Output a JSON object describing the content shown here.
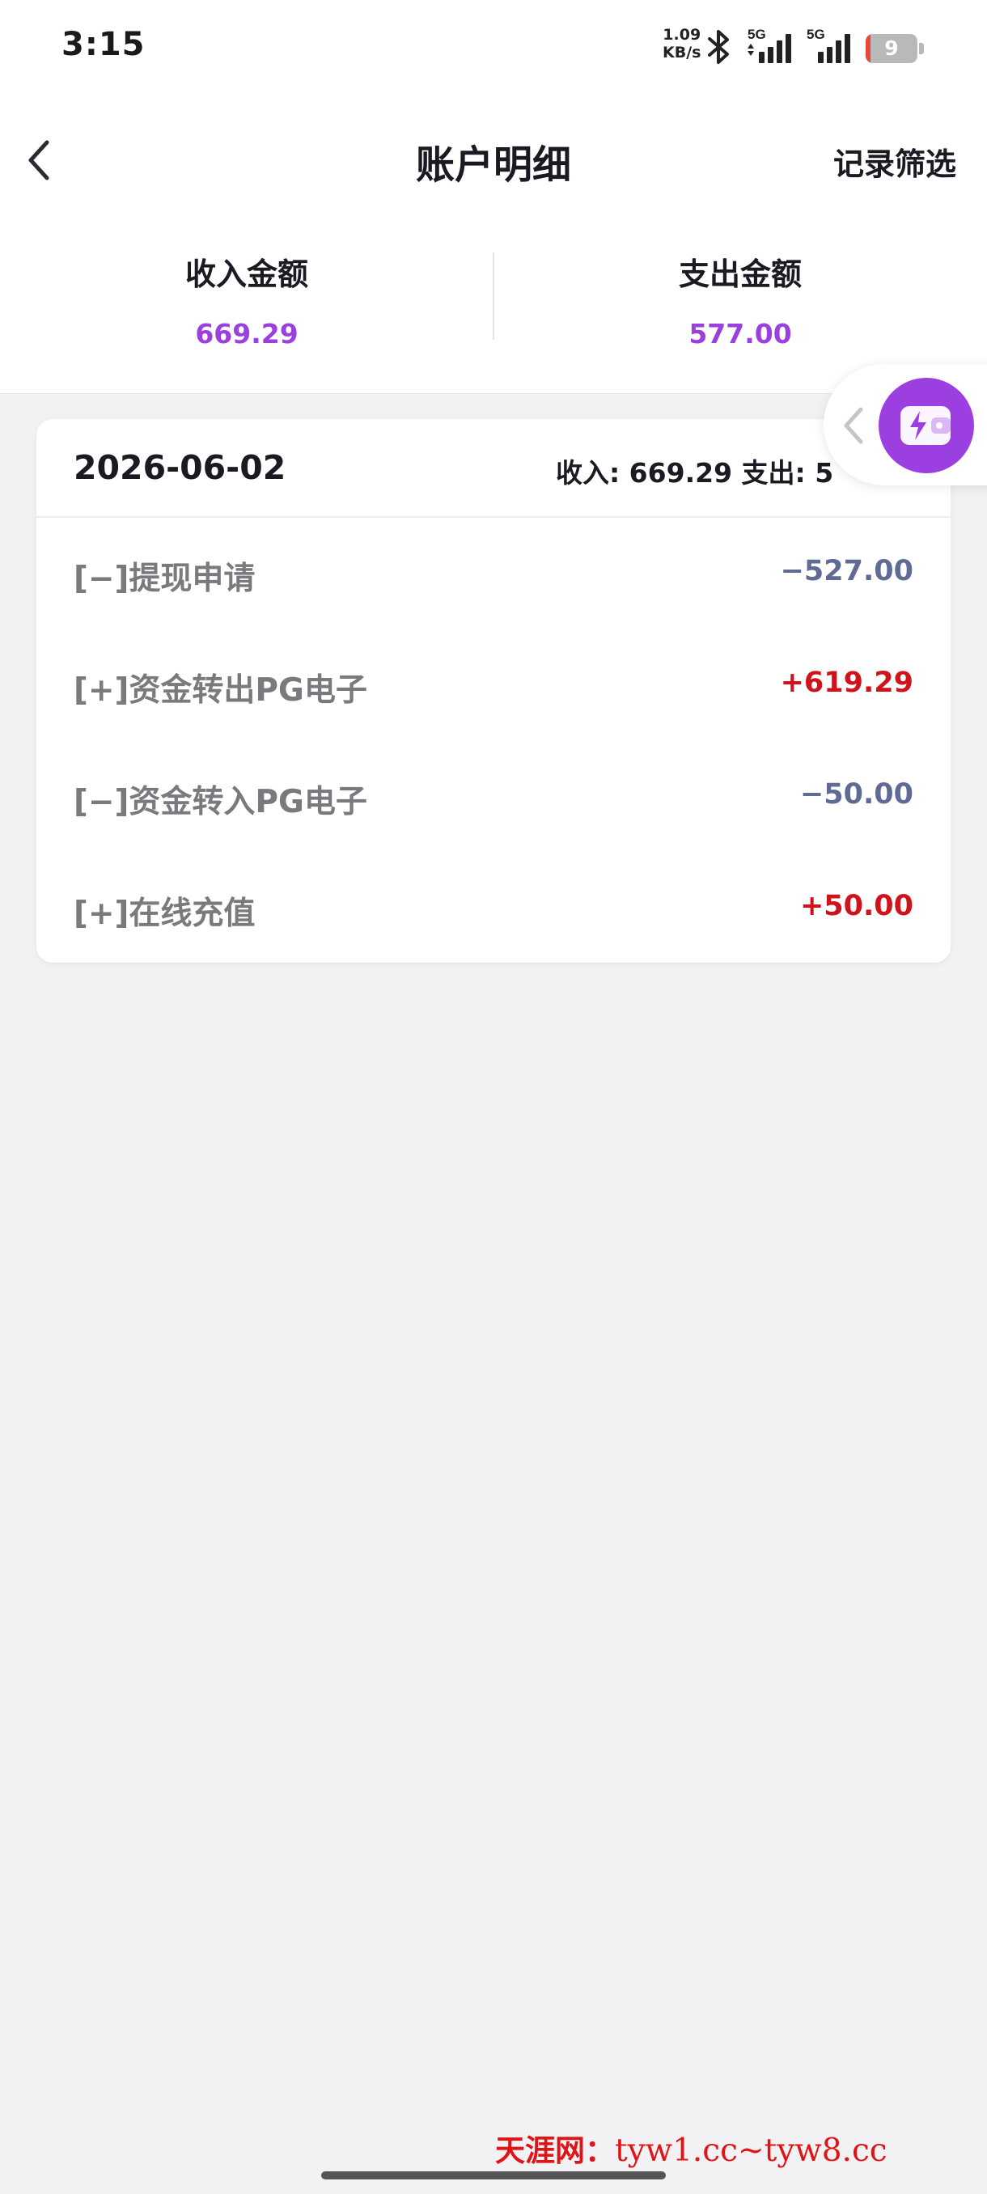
{
  "status_bar": {
    "time": "3:15",
    "net_speed_value": "1.09",
    "net_speed_unit": "KB/s",
    "signal_1_label": "5G",
    "signal_2_label": "5G",
    "battery_level": "9",
    "battery_fraction": 0.09,
    "icons": [
      "bluetooth-icon",
      "signal-icon",
      "signal-icon",
      "battery-icon"
    ]
  },
  "header": {
    "title": "账户明细",
    "filter_label": "记录筛选",
    "back_icon": "chevron-left-icon"
  },
  "summary": {
    "income_label": "收入金额",
    "income_value": "669.29",
    "expense_label": "支出金额",
    "expense_value": "577.00"
  },
  "day_group": {
    "date": "2026-06-02",
    "summary_text": "收入: 669.29 支出: 5",
    "transactions": [
      {
        "label": "[−]提现申请",
        "amount": "−527.00",
        "type": "expense"
      },
      {
        "label": "[+]资金转出PG电子",
        "amount": "+619.29",
        "type": "income"
      },
      {
        "label": "[−]资金转入PG电子",
        "amount": "−50.00",
        "type": "expense"
      },
      {
        "label": "[+]在线充值",
        "amount": "+50.00",
        "type": "income"
      }
    ]
  },
  "floating_widget": {
    "icons": [
      "chevron-left-icon",
      "wallet-lightning-icon"
    ]
  },
  "watermark": {
    "cn_text": "天涯网：",
    "url_text": "tyw1.cc~tyw8.cc"
  },
  "colors": {
    "accent": "#9b3fe0",
    "income": "#d0121b",
    "expense": "#5f6b94",
    "watermark": "#e01414"
  }
}
